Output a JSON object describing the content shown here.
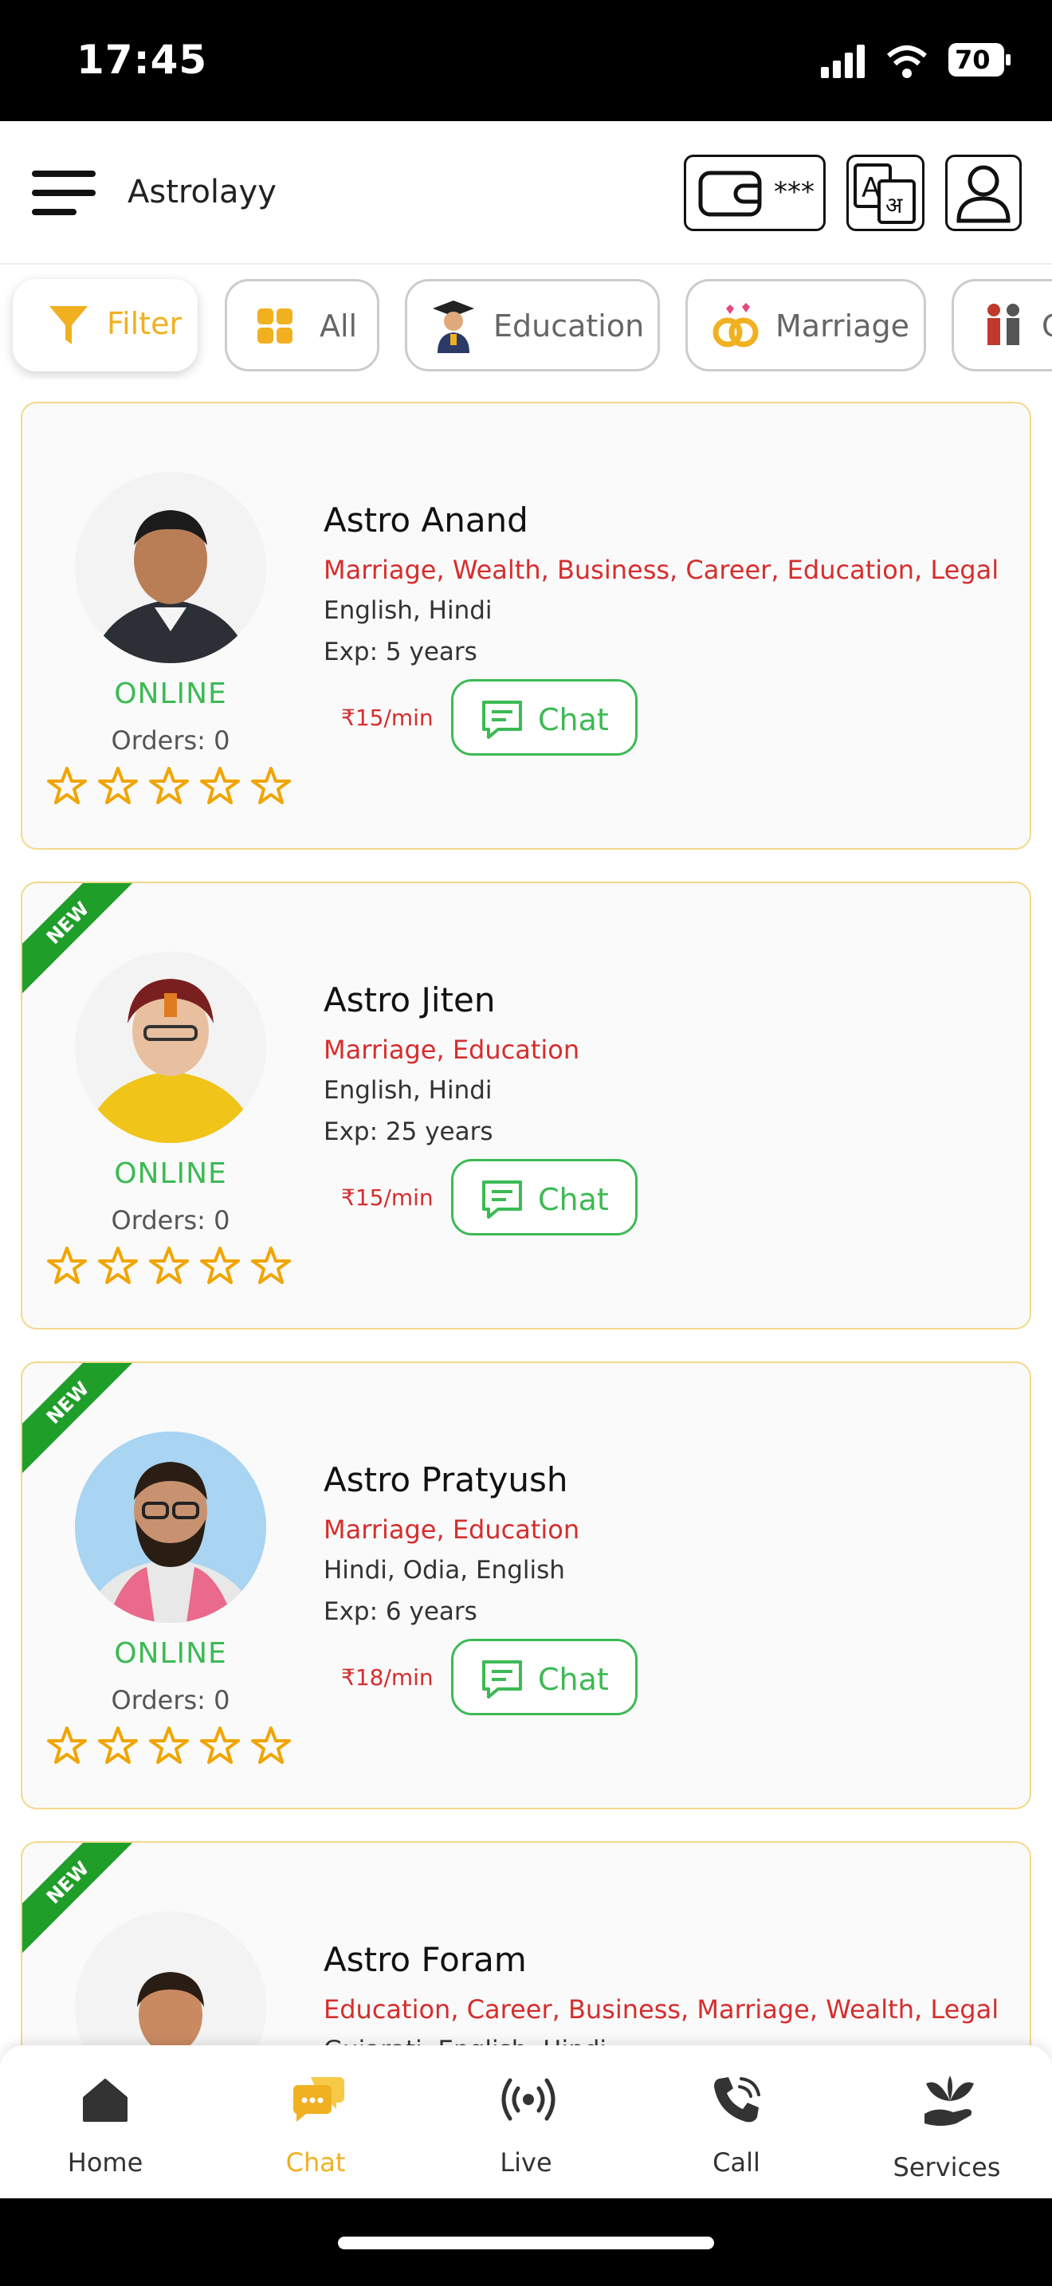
{
  "status_bar": {
    "time": "17:45",
    "battery": "70"
  },
  "header": {
    "title": "Astrolayy",
    "wallet_mask": "***"
  },
  "chips": [
    {
      "label": "Filter"
    },
    {
      "label": "All"
    },
    {
      "label": "Education"
    },
    {
      "label": "Marriage"
    },
    {
      "label": "C"
    }
  ],
  "astrologers": [
    {
      "name": "Astro Anand",
      "skills": "Marriage, Wealth, Business, Career, Education, Legal",
      "languages": "English, Hindi",
      "experience": "Exp: 5 years",
      "status": "ONLINE",
      "orders": "Orders: 0",
      "price": "₹15/min",
      "chat_label": "Chat",
      "badge": ""
    },
    {
      "name": "Astro Jiten",
      "skills": "Marriage, Education",
      "languages": "English, Hindi",
      "experience": "Exp: 25 years",
      "status": "ONLINE",
      "orders": "Orders: 0",
      "price": "₹15/min",
      "chat_label": "Chat",
      "badge": "NEW"
    },
    {
      "name": "Astro Pratyush",
      "skills": "Marriage, Education",
      "languages": "Hindi, Odia, English",
      "experience": "Exp: 6 years",
      "status": "ONLINE",
      "orders": "Orders: 0",
      "price": "₹18/min",
      "chat_label": "Chat",
      "badge": "NEW"
    },
    {
      "name": "Astro Foram",
      "skills": "Education, Career, Business, Marriage, Wealth, Legal",
      "languages": "Gujarati, English, Hindi",
      "experience": "",
      "status": "",
      "orders": "",
      "price": "",
      "chat_label": "",
      "badge": "NEW"
    }
  ],
  "bottom_nav": [
    {
      "label": "Home",
      "icon": "home-icon"
    },
    {
      "label": "Chat",
      "icon": "chat-bubbles-icon",
      "active": true
    },
    {
      "label": "Live",
      "icon": "broadcast-icon"
    },
    {
      "label": "Call",
      "icon": "phone-icon"
    },
    {
      "label": "Services",
      "icon": "hand-plant-icon"
    }
  ],
  "colors": {
    "accent": "#f0b020",
    "online": "#3cba54",
    "skills": "#d62d2d",
    "badge": "#1f9e2a"
  }
}
